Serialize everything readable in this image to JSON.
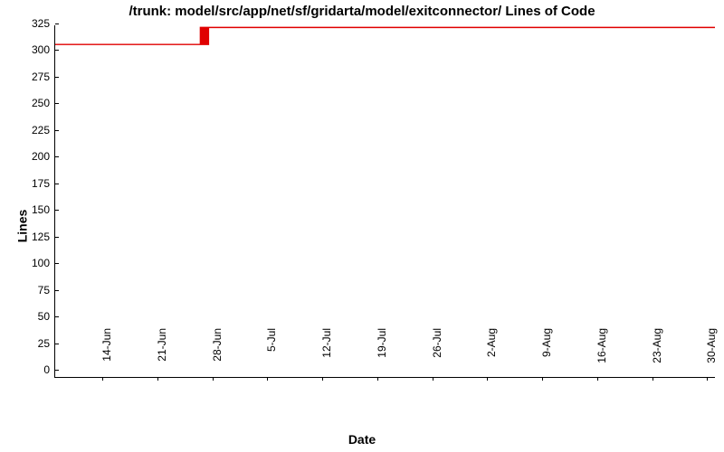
{
  "chart_data": {
    "type": "line",
    "title": "/trunk: model/src/app/net/sf/gridarta/model/exitconnector/ Lines of Code",
    "xlabel": "Date",
    "ylabel": "Lines",
    "ylim": [
      0,
      330
    ],
    "yticks": [
      0,
      25,
      50,
      75,
      100,
      125,
      150,
      175,
      200,
      225,
      250,
      275,
      300,
      325
    ],
    "xticks": [
      "14-Jun",
      "21-Jun",
      "28-Jun",
      "5-Jul",
      "12-Jul",
      "19-Jul",
      "26-Jul",
      "2-Aug",
      "9-Aug",
      "16-Aug",
      "23-Aug",
      "30-Aug"
    ],
    "series": [
      {
        "name": "Lines of Code",
        "color": "#e00000",
        "points": [
          {
            "x": "8-Jun",
            "y": 312
          },
          {
            "x": "27-Jun",
            "y": 312
          },
          {
            "x": "27-Jun",
            "y": 328
          },
          {
            "x": "31-Aug",
            "y": 328
          }
        ]
      }
    ]
  }
}
